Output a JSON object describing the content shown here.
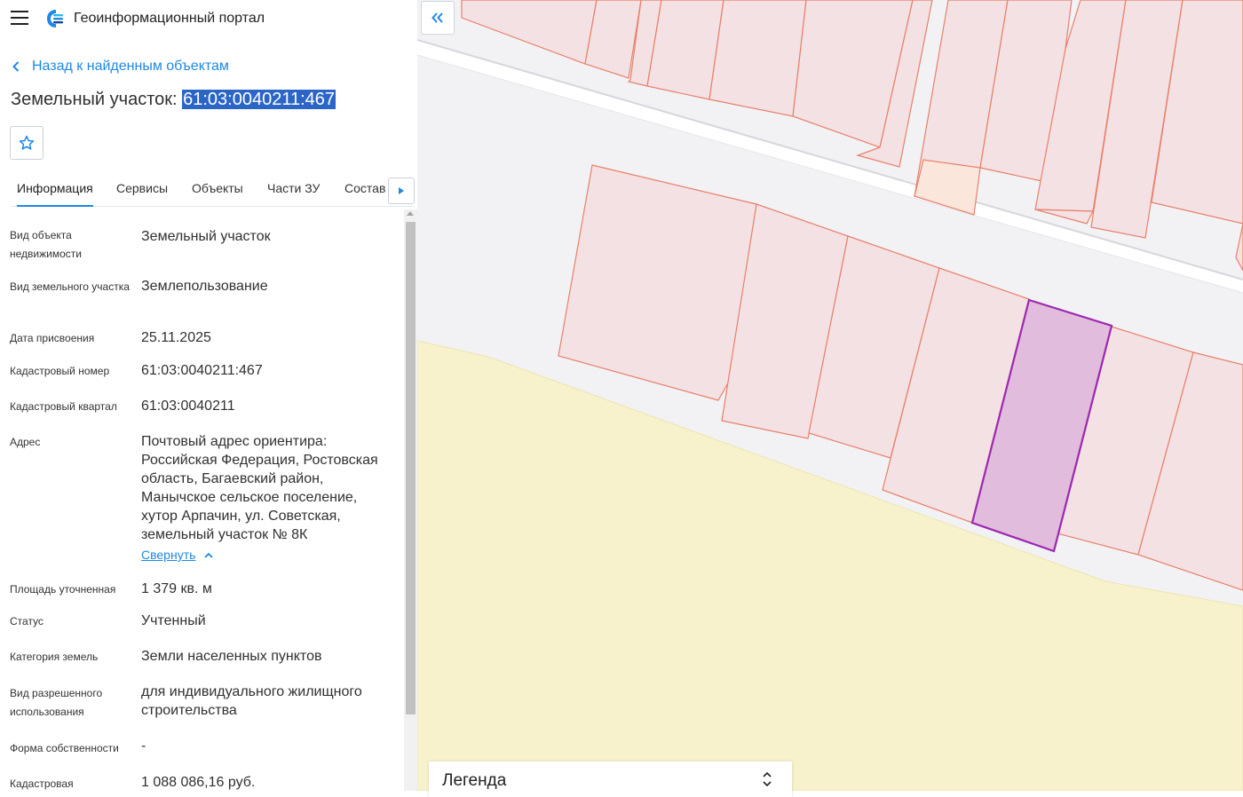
{
  "app": {
    "title": "Геоинформационный портал"
  },
  "nav": {
    "back_label": "Назад к найденным объектам"
  },
  "object": {
    "title_prefix": "Земельный участок:",
    "title_number": "61:03:0040211:467"
  },
  "tabs": [
    {
      "label": "Информация",
      "active": true
    },
    {
      "label": "Сервисы"
    },
    {
      "label": "Объекты"
    },
    {
      "label": "Части ЗУ"
    },
    {
      "label": "Состав"
    }
  ],
  "info": [
    {
      "label": "Вид объекта недвижимости",
      "value": "Земельный участок"
    },
    {
      "label": "Вид земельного участка",
      "value": "Землепользование"
    },
    {
      "label": "Дата присвоения",
      "value": "25.11.2025"
    },
    {
      "label": "Кадастровый номер",
      "value": "61:03:0040211:467"
    },
    {
      "label": "Кадастровый квартал",
      "value": "61:03:0040211"
    },
    {
      "label": "Адрес",
      "value": "Почтовый адрес ориентира: Российская Федерация, Ростовская область, Багаевский район, Манычское сельское поселение, хутор Арпачин, ул. Советская, земельный участок № 8К"
    },
    {
      "label": "Площадь уточненная",
      "value": "1 379 кв. м"
    },
    {
      "label": "Статус",
      "value": "Учтенный"
    },
    {
      "label": "Категория земель",
      "value": "Земли населенных пунктов"
    },
    {
      "label": "Вид разрешенного использования",
      "value": "для индивидуального жилищного строительства"
    },
    {
      "label": "Форма собственности",
      "value": "-"
    },
    {
      "label": "Кадастровая",
      "value": "1 088 086,16 руб."
    }
  ],
  "address_toggle": {
    "label": "Свернуть"
  },
  "legend": {
    "label": "Легенда"
  },
  "colors": {
    "accent": "#1e88e5",
    "parcel_fill": "#f4e1e3",
    "parcel_stroke": "#e8806a",
    "selected_fill": "#e1bcdc",
    "selected_stroke": "#9c27b0",
    "field_fill": "#f7f2cc"
  },
  "icons": {
    "menu": "hamburger-icon",
    "logo": "portal-logo-icon",
    "back": "chevron-left-icon",
    "favorite": "star-outline-icon",
    "tab_scroll": "triangle-right-icon",
    "collapse_toggle": "chevron-up-icon",
    "collapse_panel": "double-chevron-left-icon",
    "legend_toggle": "chevrons-up-down-icon"
  }
}
